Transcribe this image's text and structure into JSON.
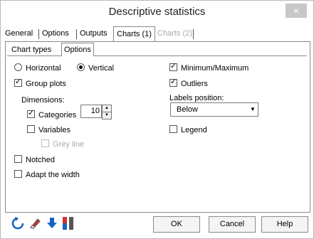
{
  "window": {
    "title": "Descriptive statistics",
    "close_glyph": "×"
  },
  "tabs": {
    "general": "General",
    "options": "Options",
    "outputs": "Outputs",
    "charts1": "Charts (1)",
    "charts2": "Charts (2)"
  },
  "subtabs": {
    "chart_types": "Chart types",
    "options": "Options"
  },
  "orientation": {
    "horizontal": "Horizontal",
    "vertical": "Vertical",
    "selected": "vertical"
  },
  "left": {
    "group_plots": {
      "label": "Group plots",
      "checked": true
    },
    "dimensions": {
      "label": "Dimensions:",
      "value": "10"
    },
    "categories": {
      "label": "Categories",
      "checked": true
    },
    "variables": {
      "label": "Variables",
      "checked": false
    },
    "grey_line": {
      "label": "Grey line",
      "checked": false
    },
    "notched": {
      "label": "Notched",
      "checked": false
    },
    "adapt_width": {
      "label": "Adapt the width",
      "checked": false
    }
  },
  "right": {
    "minmax": {
      "label": "Minimum/Maximum",
      "checked": true
    },
    "outliers": {
      "label": "Outliers",
      "checked": true
    },
    "labels_position": {
      "label": "Labels position:",
      "value": "Below"
    },
    "legend": {
      "label": "Legend",
      "checked": false
    }
  },
  "buttons": {
    "ok": "OK",
    "cancel": "Cancel",
    "help": "Help"
  },
  "icons": [
    "reset-icon",
    "eraser-icon",
    "download-arrow-icon",
    "chart-bars-icon"
  ],
  "colors": {
    "title_text": "#222222",
    "close_bg": "#c7c7c7",
    "disabled_text": "#a9a9a9",
    "reset_icon": "#1565c0",
    "arrow_icon": "#1565c0",
    "bar_red": "#d32f2f"
  }
}
